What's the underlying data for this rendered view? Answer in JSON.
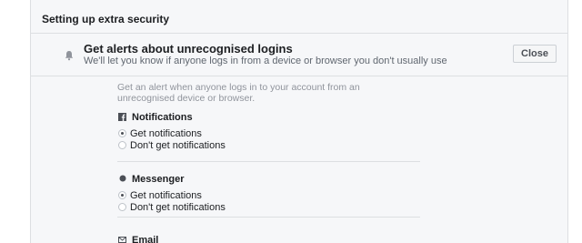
{
  "section": {
    "title": "Setting up extra security"
  },
  "alerts": {
    "title": "Get alerts about unrecognised logins",
    "subtitle": "We'll let you know if anyone logs in from a device or browser you don't usually use",
    "close_label": "Close",
    "description": "Get an alert when anyone logs in to your account from an unrecognised device or browser."
  },
  "channels": {
    "notifications": {
      "title": "Notifications",
      "icon": "facebook-icon",
      "options": [
        "Get notifications",
        "Don't get notifications"
      ],
      "selected": "Get notifications"
    },
    "messenger": {
      "title": "Messenger",
      "icon": "messenger-icon",
      "options": [
        "Get notifications",
        "Don't get notifications"
      ],
      "selected": "Get notifications"
    },
    "email": {
      "title": "Email",
      "icon": "email-icon"
    }
  }
}
